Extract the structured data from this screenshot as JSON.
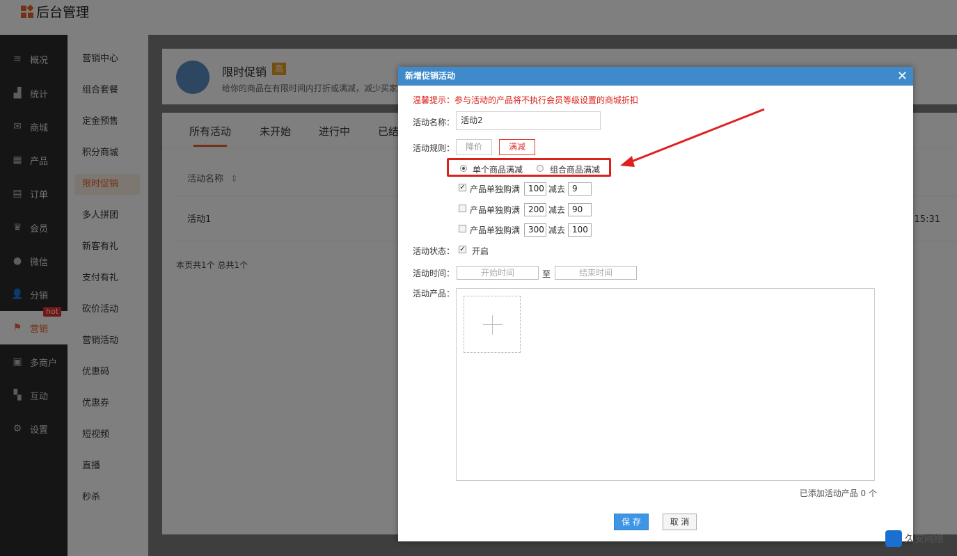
{
  "app": {
    "title": "后台管理"
  },
  "nav": [
    {
      "label": "概况",
      "icon": "layers-icon"
    },
    {
      "label": "统计",
      "icon": "chart-icon"
    },
    {
      "label": "商城",
      "icon": "mail-icon"
    },
    {
      "label": "产品",
      "icon": "grid-icon"
    },
    {
      "label": "订单",
      "icon": "clipboard-icon"
    },
    {
      "label": "会员",
      "icon": "crown-icon"
    },
    {
      "label": "微信",
      "icon": "wechat-icon"
    },
    {
      "label": "分销",
      "icon": "users-icon"
    },
    {
      "label": "营销",
      "icon": "flag-icon",
      "badge": "hot"
    },
    {
      "label": "多商户",
      "icon": "store-icon"
    },
    {
      "label": "互动",
      "icon": "apps-icon"
    },
    {
      "label": "设置",
      "icon": "gear-icon"
    }
  ],
  "subnav": [
    "营销中心",
    "组合套餐",
    "定金预售",
    "积分商城",
    "限时促销",
    "多人拼团",
    "新客有礼",
    "支付有礼",
    "砍价活动",
    "营销活动",
    "优惠码",
    "优惠券",
    "短视频",
    "直播",
    "秒杀"
  ],
  "promo": {
    "title": "限时促销",
    "badge": "高",
    "desc": "给你的商品在有限时间内打折或满减，减少买家"
  },
  "tabs": [
    "所有活动",
    "未开始",
    "进行中",
    "已结"
  ],
  "table": {
    "header": "活动名称",
    "row_name": "活动1",
    "row_time": "15:31"
  },
  "pager": "本页共1个 总共1个",
  "modal": {
    "title": "新增促销活动",
    "close": "✕",
    "tip": "温馨提示：参与活动的产品将不执行会员等级设置的商城折扣",
    "name_label": "活动名称：",
    "name_value": "活动2",
    "rule_label": "活动规则：",
    "rule_options": [
      "降价",
      "满减"
    ],
    "rule_selected": "满减",
    "mode_options": [
      "单个商品满减",
      "组合商品满减"
    ],
    "tiers": [
      {
        "checked": true,
        "label": "产品单独购满",
        "amount": "100",
        "minus_label": "减去",
        "minus": "9"
      },
      {
        "checked": false,
        "label": "产品单独购满",
        "amount": "200",
        "minus_label": "减去",
        "minus": "90"
      },
      {
        "checked": false,
        "label": "产品单独购满",
        "amount": "300",
        "minus_label": "减去",
        "minus": "100"
      }
    ],
    "status_label": "活动状态：",
    "status_value": "开启",
    "time_label": "活动时间：",
    "start_placeholder": "开始时间",
    "to": "至",
    "end_placeholder": "结束时间",
    "product_label": "活动产品：",
    "added_count": "已添加活动产品 0 个",
    "save": "保 存",
    "cancel": "取 消"
  },
  "watermark": "久安网络",
  "colors": {
    "accent": "#e8632a",
    "modal_header": "#3e8acb",
    "warning": "#d8201c",
    "primary_button": "#3e95e6"
  }
}
